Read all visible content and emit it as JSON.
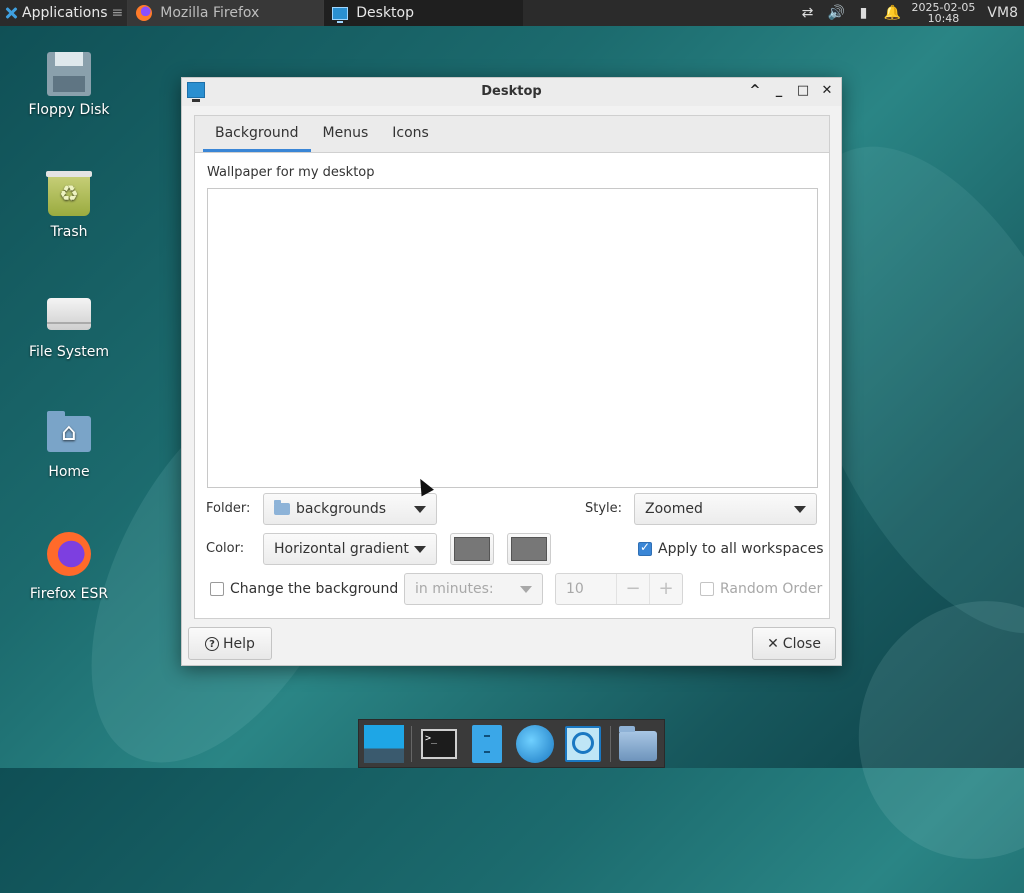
{
  "top_panel": {
    "applications_label": "Applications",
    "tasks": [
      {
        "label": "Mozilla Firefox"
      },
      {
        "label": "Desktop"
      }
    ],
    "clock_date": "2025-02-05",
    "clock_time": "10:48",
    "host_label": "VM8"
  },
  "desktop_icons": [
    {
      "label": "Floppy Disk"
    },
    {
      "label": "Trash"
    },
    {
      "label": "File System"
    },
    {
      "label": "Home"
    },
    {
      "label": "Firefox ESR"
    }
  ],
  "window": {
    "title": "Desktop",
    "tabs": [
      {
        "label": "Background"
      },
      {
        "label": "Menus"
      },
      {
        "label": "Icons"
      }
    ],
    "wallpaper_label": "Wallpaper for my desktop",
    "folder_label": "Folder:",
    "folder_value": "backgrounds",
    "style_label": "Style:",
    "style_value": "Zoomed",
    "color_label": "Color:",
    "color_value": "Horizontal gradient",
    "color_swatches": [
      "#777777",
      "#777777"
    ],
    "apply_all_label": "Apply to all workspaces",
    "apply_all_checked": true,
    "change_bg_label": "Change the background",
    "change_bg_checked": false,
    "interval_placeholder": "in minutes:",
    "interval_value": "10",
    "random_order_label": "Random Order",
    "random_order_checked": false,
    "help_label": "Help",
    "close_label": "Close"
  },
  "accent_color": "#3a86d6"
}
